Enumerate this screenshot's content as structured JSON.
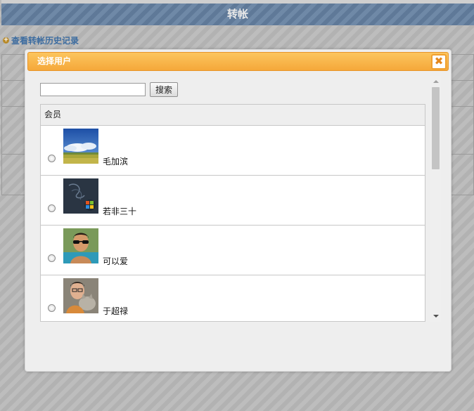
{
  "page": {
    "title": "转帐",
    "history_link": "查看转帐历史记录"
  },
  "dialog": {
    "title": "选择用户",
    "close_symbol": "✖",
    "search": {
      "value": "",
      "placeholder": "",
      "button_label": "搜索"
    },
    "list": {
      "column_header": "会员",
      "members": [
        {
          "name": "毛加滨",
          "avatar": "landscape-sky-field"
        },
        {
          "name": "若非三十",
          "avatar": "windows-logo-dark"
        },
        {
          "name": "可以爱",
          "avatar": "person-sunglasses-pool"
        },
        {
          "name": "于超禄",
          "avatar": "person-with-cat"
        }
      ]
    }
  },
  "colors": {
    "title_bar": "#f5a83a",
    "header_bar": "#6c86a4",
    "link": "#3c6ca0"
  }
}
